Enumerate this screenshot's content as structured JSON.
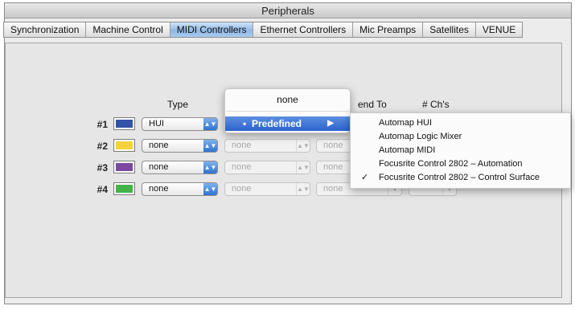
{
  "window": {
    "title": "Peripherals"
  },
  "tabs": [
    {
      "label": "Synchronization"
    },
    {
      "label": "Machine Control"
    },
    {
      "label": "MIDI Controllers"
    },
    {
      "label": "Ethernet Controllers"
    },
    {
      "label": "Mic Preamps"
    },
    {
      "label": "Satellites"
    },
    {
      "label": "VENUE"
    }
  ],
  "columns": {
    "type": "Type",
    "send_to": "end To",
    "channels": "# Ch's"
  },
  "rows": [
    {
      "label": "#1",
      "color": "#3352a8",
      "type": "HUI",
      "receive": "",
      "send": ""
    },
    {
      "label": "#2",
      "color": "#f4d23c",
      "type": "none",
      "receive": "none",
      "send": "none"
    },
    {
      "label": "#3",
      "color": "#7e48a0",
      "type": "none",
      "receive": "none",
      "send": "none"
    },
    {
      "label": "#4",
      "color": "#46b24a",
      "type": "none",
      "receive": "none",
      "send": "none"
    }
  ],
  "type_menu": {
    "none_label": "none",
    "highlight_bullet": "•",
    "highlight_label": "Predefined",
    "submenu_arrow": "▶"
  },
  "predefined_menu": {
    "items": [
      {
        "label": "Automap HUI",
        "checked": false
      },
      {
        "label": "Automap Logic Mixer",
        "checked": false
      },
      {
        "label": "Automap MIDI",
        "checked": false
      },
      {
        "label": "Focusrite Control 2802 – Automation",
        "checked": false
      },
      {
        "label": "Focusrite Control 2802 – Control Surface",
        "checked": true
      }
    ],
    "check_glyph": "✓"
  },
  "icons": {
    "select_arrow": "updown-arrows-icon",
    "submenu": "triangle-right-icon",
    "check": "checkmark-icon"
  },
  "colors": {
    "accent": "#2f74cf",
    "tab_active": "#a9cbef"
  }
}
